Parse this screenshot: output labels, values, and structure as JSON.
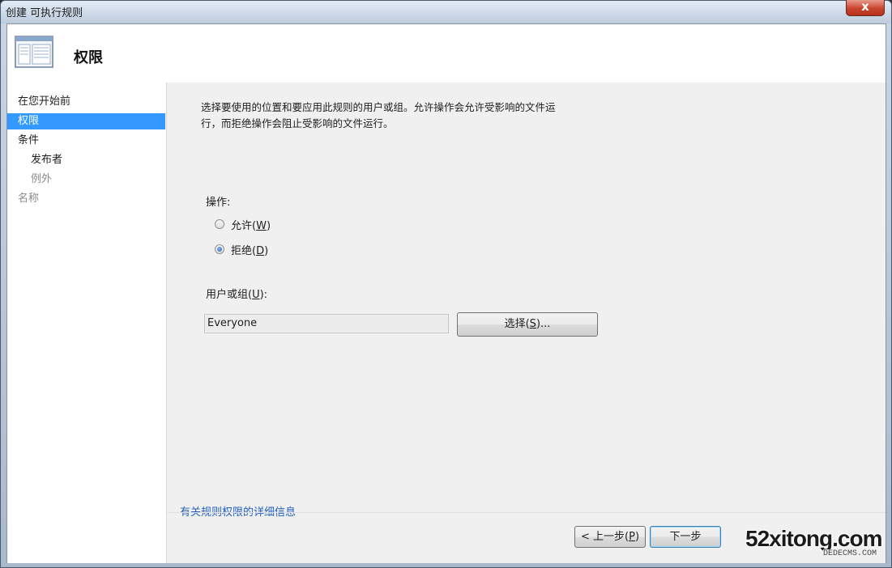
{
  "window": {
    "title": "创建 可执行规则",
    "close_glyph": "x"
  },
  "header": {
    "title": "权限",
    "icon": "window-page-icon"
  },
  "sidebar": {
    "items": [
      {
        "label": "在您开始前",
        "state": "normal"
      },
      {
        "label": "权限",
        "state": "selected"
      },
      {
        "label": "条件",
        "state": "normal"
      },
      {
        "label": "发布者",
        "state": "normal"
      },
      {
        "label": "例外",
        "state": "disabled"
      },
      {
        "label": "名称",
        "state": "disabled"
      }
    ]
  },
  "content": {
    "description_line1": "选择要使用的位置和要应用此规则的用户或组。允许操作会允许受影响的文件运",
    "description_line2": "行，而拒绝操作会阻止受影响的文件运行。",
    "action_label": "操作:",
    "radio_allow": {
      "label": "允许(",
      "key": "W",
      "suffix": ")",
      "checked": false
    },
    "radio_deny": {
      "label": "拒绝(",
      "key": "D",
      "suffix": ")",
      "checked": true
    },
    "user_group_label_prefix": "用户或组(",
    "user_group_key": "U",
    "user_group_label_suffix": "):",
    "user_group_value": "Everyone",
    "choose_button_prefix": "选择(",
    "choose_button_key": "S",
    "choose_button_suffix": ")...",
    "help_link": "有关规则权限的详细信息"
  },
  "footer": {
    "prev_prefix": "< 上一步(",
    "prev_key": "P",
    "prev_suffix": ")",
    "next_label": "下一步"
  },
  "watermark": {
    "main": "52xitong.com",
    "sub": "DEDECMS.COM"
  },
  "colors": {
    "selection": "#3399ff",
    "link": "#1f5fbf",
    "close": "#c8452f"
  }
}
